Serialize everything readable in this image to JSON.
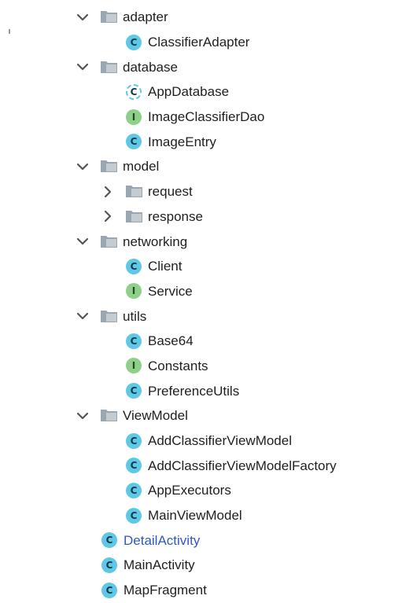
{
  "tree": {
    "rows": [
      {
        "kind": "folder",
        "level": 0,
        "expanded": true,
        "label": "adapter",
        "icon": "folder-icon"
      },
      {
        "kind": "class",
        "level": 1,
        "type": "C",
        "label": "ClassifierAdapter",
        "icon": "class-icon"
      },
      {
        "kind": "folder",
        "level": 0,
        "expanded": true,
        "label": "database",
        "icon": "folder-icon"
      },
      {
        "kind": "class",
        "level": 1,
        "type": "abstract",
        "label": "AppDatabase",
        "icon": "abstract-class-icon"
      },
      {
        "kind": "class",
        "level": 1,
        "type": "I",
        "label": "ImageClassifierDao",
        "icon": "interface-icon"
      },
      {
        "kind": "class",
        "level": 1,
        "type": "C",
        "label": "ImageEntry",
        "icon": "class-icon"
      },
      {
        "kind": "folder",
        "level": 0,
        "expanded": true,
        "label": "model",
        "icon": "folder-icon"
      },
      {
        "kind": "folder",
        "level": 1,
        "expanded": false,
        "label": "request",
        "icon": "folder-icon"
      },
      {
        "kind": "folder",
        "level": 1,
        "expanded": false,
        "label": "response",
        "icon": "folder-icon"
      },
      {
        "kind": "folder",
        "level": 0,
        "expanded": true,
        "label": "networking",
        "icon": "folder-icon"
      },
      {
        "kind": "class",
        "level": 1,
        "type": "C",
        "label": "Client",
        "icon": "class-icon"
      },
      {
        "kind": "class",
        "level": 1,
        "type": "I",
        "label": "Service",
        "icon": "interface-icon"
      },
      {
        "kind": "folder",
        "level": 0,
        "expanded": true,
        "label": "utils",
        "icon": "folder-icon"
      },
      {
        "kind": "class",
        "level": 1,
        "type": "C",
        "label": "Base64",
        "icon": "class-icon"
      },
      {
        "kind": "class",
        "level": 1,
        "type": "I",
        "label": "Constants",
        "icon": "interface-icon"
      },
      {
        "kind": "class",
        "level": 1,
        "type": "C",
        "label": "PreferenceUtils",
        "icon": "class-icon"
      },
      {
        "kind": "folder",
        "level": 0,
        "expanded": true,
        "label": "ViewModel",
        "icon": "folder-icon"
      },
      {
        "kind": "class",
        "level": 1,
        "type": "C",
        "label": "AddClassifierViewModel",
        "icon": "class-icon"
      },
      {
        "kind": "class",
        "level": 1,
        "type": "C",
        "label": "AddClassifierViewModelFactory",
        "icon": "class-icon"
      },
      {
        "kind": "class",
        "level": 1,
        "type": "C",
        "label": "AppExecutors",
        "icon": "class-icon"
      },
      {
        "kind": "class",
        "level": 1,
        "type": "C",
        "label": "MainViewModel",
        "icon": "class-icon"
      },
      {
        "kind": "class",
        "level": 0,
        "type": "C",
        "label": "DetailActivity",
        "icon": "class-icon",
        "highlight": true
      },
      {
        "kind": "class",
        "level": 0,
        "type": "C",
        "label": "MainActivity",
        "icon": "class-icon"
      },
      {
        "kind": "class",
        "level": 0,
        "type": "C",
        "label": "MapFragment",
        "icon": "class-icon"
      }
    ]
  },
  "icon_letters": {
    "C": "C",
    "I": "I",
    "abstract": "C"
  },
  "colors": {
    "class_icon": "#5ec8e6",
    "interface_icon": "#8ed08a",
    "folder": "#9aa7b0",
    "highlight_text": "#2f5bbd",
    "text": "#1f1f1f"
  }
}
